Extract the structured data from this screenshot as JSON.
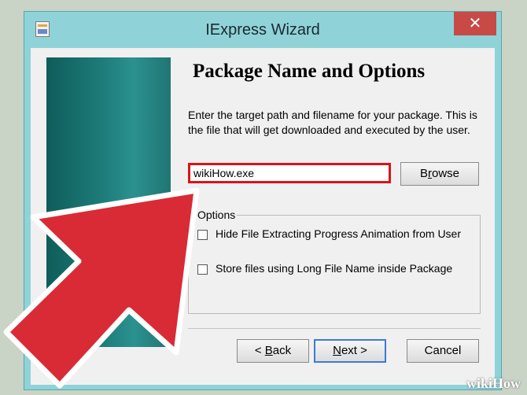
{
  "window": {
    "title": "IExpress Wizard",
    "close_glyph": "✕"
  },
  "page": {
    "heading": "Package Name and Options",
    "description": "Enter the target path and filename for your package. This is the file that will get downloaded and executed by the user."
  },
  "path_field": {
    "value": "wikiHow.exe"
  },
  "buttons": {
    "browse": "Browse",
    "back": "< Back",
    "next": "Next >",
    "cancel": "Cancel"
  },
  "options": {
    "legend": "Options",
    "items": [
      {
        "label": "Hide File Extracting Progress Animation from User",
        "checked": false
      },
      {
        "label": "Store files using Long File Name inside Package",
        "checked": false
      }
    ]
  },
  "overlay": {
    "arrow_color": "#d92b35",
    "highlight_color": "#d9141b",
    "watermark": "wikiHow"
  }
}
